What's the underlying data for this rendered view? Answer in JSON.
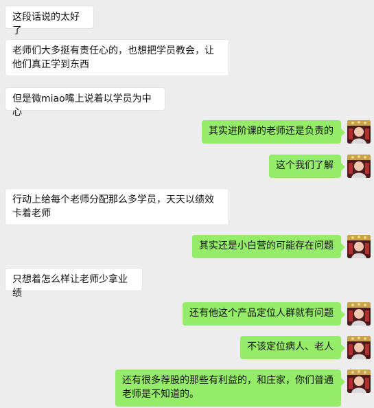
{
  "messages": [
    {
      "side": "in",
      "text": "这段话说的太好了"
    },
    {
      "side": "in",
      "text": "老师们大多挺有责任心的，也想把学员教会，让他们真正学到东西"
    },
    {
      "side": "in",
      "text": "但是微miao嘴上说着以学员为中心"
    },
    {
      "side": "out",
      "text": "其实进阶课的老师还是负责的"
    },
    {
      "side": "out",
      "text": "这个我们了解"
    },
    {
      "side": "in",
      "text": "行动上给每个老师分配那么多学员，天天以绩效卡着老师"
    },
    {
      "side": "out",
      "text": "其实还是小白营的可能存在问题"
    },
    {
      "side": "in",
      "text": "只想着怎么样让老师少拿业绩"
    },
    {
      "side": "out",
      "text": "还有他这个产品定位人群就有问题"
    },
    {
      "side": "out",
      "text": "不该定位病人、老人"
    },
    {
      "side": "out",
      "text": "还有很多荐股的那些有利益的，和庄家，你们普通老师是不知道的。"
    }
  ],
  "colors": {
    "background": "#ededed",
    "incoming_bubble": "#ffffff",
    "outgoing_bubble": "#95ec69"
  },
  "icons": {
    "avatar": "user-avatar-icon"
  }
}
